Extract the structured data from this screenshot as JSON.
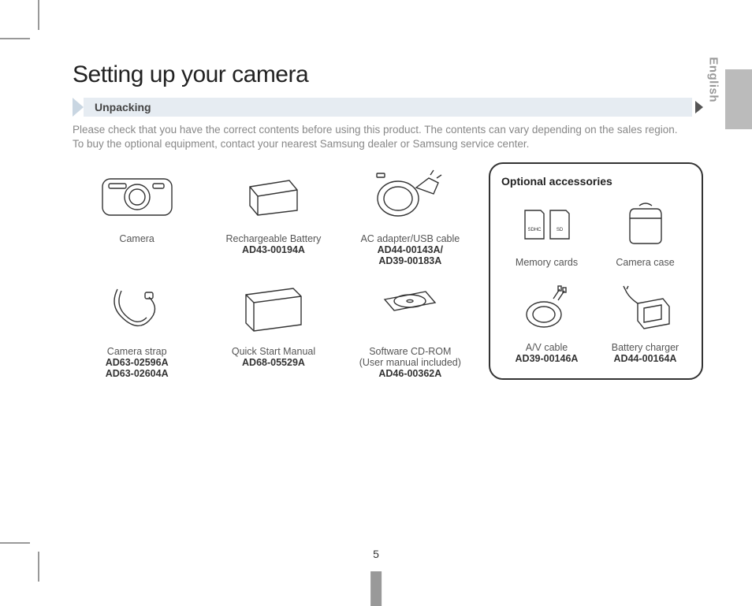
{
  "page": {
    "title": "Setting up your camera",
    "section": "Unpacking",
    "intro_line1": "Please check that you have the correct contents before using this product. The contents can vary depending on the sales region.",
    "intro_line2": "To buy the optional equipment, contact your nearest Samsung dealer or Samsung service center.",
    "language_tab": "English",
    "page_number": "5"
  },
  "items": [
    {
      "label": "Camera",
      "parts": []
    },
    {
      "label": "Rechargeable Battery",
      "parts": [
        "AD43-00194A"
      ]
    },
    {
      "label": "AC adapter/USB cable",
      "parts": [
        "AD44-00143A/",
        "AD39-00183A"
      ]
    },
    {
      "label": "Camera strap",
      "parts": [
        "AD63-02596A",
        "AD63-02604A"
      ]
    },
    {
      "label": "Quick Start Manual",
      "parts": [
        "AD68-05529A"
      ]
    },
    {
      "label": "Software CD-ROM",
      "sub": "(User manual included)",
      "parts": [
        "AD46-00362A"
      ]
    }
  ],
  "optional": {
    "title": "Optional accessories",
    "items": [
      {
        "label": "Memory cards",
        "parts": []
      },
      {
        "label": "Camera case",
        "parts": []
      },
      {
        "label": "A/V cable",
        "parts": [
          "AD39-00146A"
        ]
      },
      {
        "label": "Battery charger",
        "parts": [
          "AD44-00164A"
        ]
      }
    ]
  }
}
